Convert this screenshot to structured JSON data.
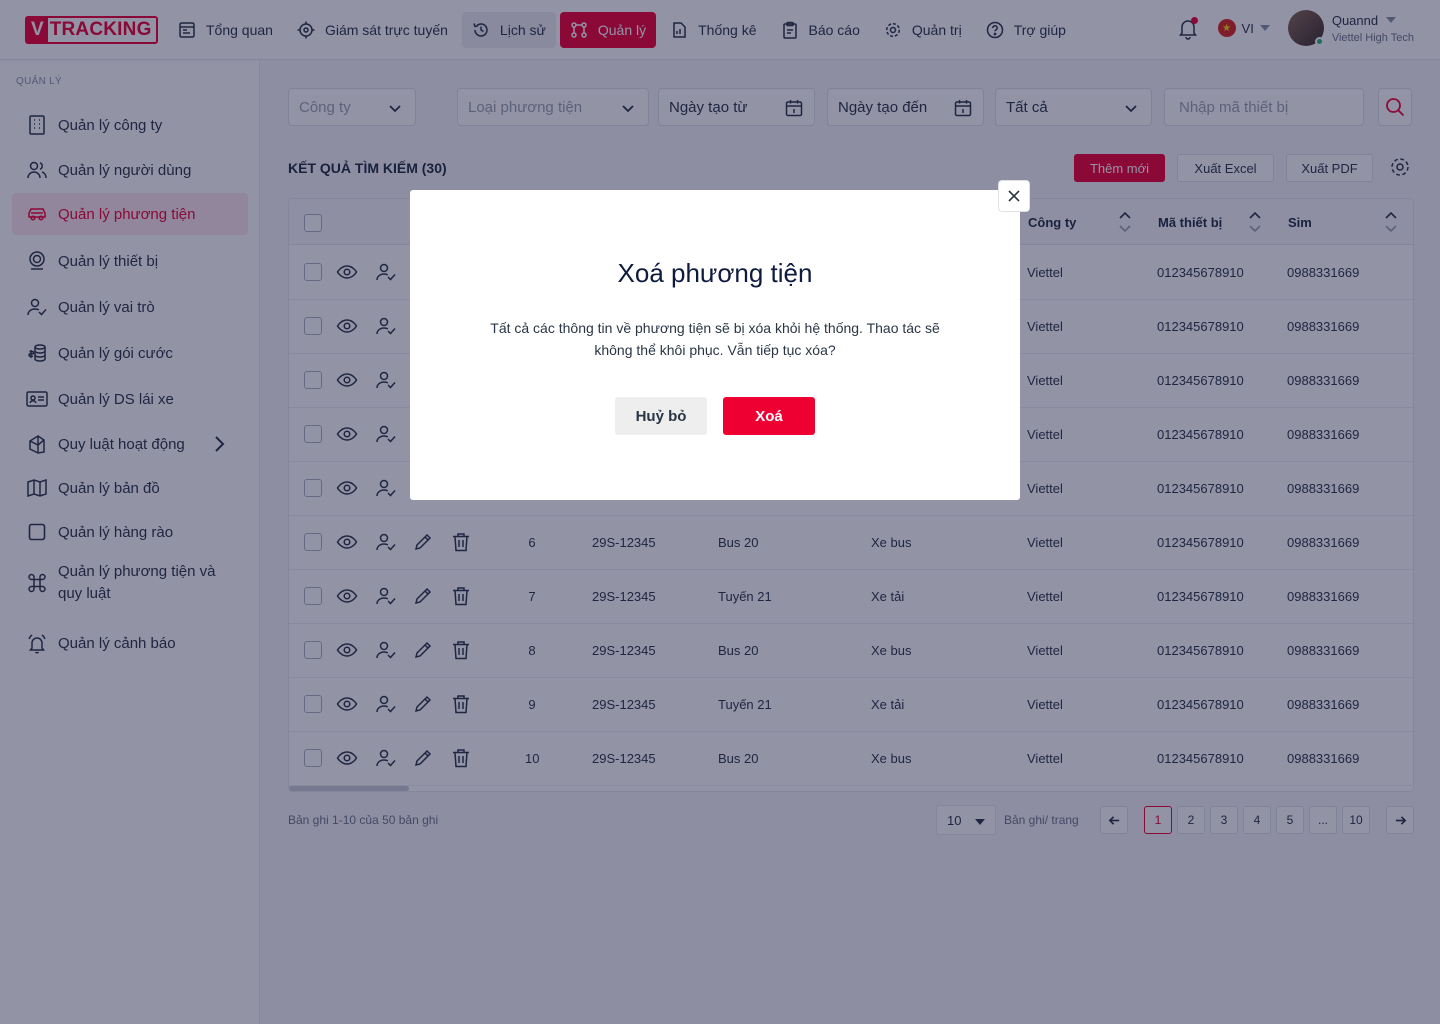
{
  "brand": {
    "logo_v": "V",
    "logo_text": "TRACKING",
    "color": "#ee0033"
  },
  "nav": [
    {
      "label": "Tổng quan",
      "icon": "dashboard-icon"
    },
    {
      "label": "Giám sát trực tuyến",
      "icon": "target-icon"
    },
    {
      "label": "Lịch sử",
      "icon": "history-icon"
    },
    {
      "label": "Quản lý",
      "icon": "manage-icon",
      "active": true
    },
    {
      "label": "Thống kê",
      "icon": "stats-icon"
    },
    {
      "label": "Báo cáo",
      "icon": "report-icon"
    },
    {
      "label": "Quản trị",
      "icon": "gear-icon"
    },
    {
      "label": "Trợ giúp",
      "icon": "help-icon"
    }
  ],
  "header_right": {
    "lang": "VI",
    "user_name": "Quannd",
    "user_org": "Viettel High Tech"
  },
  "sidebar": {
    "title": "QUẢN LÝ",
    "items": [
      {
        "label": "Quản lý công ty",
        "icon": "building-icon"
      },
      {
        "label": "Quản lý người dùng",
        "icon": "users-icon"
      },
      {
        "label": "Quản lý phương tiện",
        "icon": "car-icon",
        "active": true
      },
      {
        "label": "Quản lý thiết bị",
        "icon": "device-icon"
      },
      {
        "label": "Quản lý vai trò",
        "icon": "user-check-icon"
      },
      {
        "label": "Quản lý gói cước",
        "icon": "coins-icon"
      },
      {
        "label": "Quản lý DS lái xe",
        "icon": "id-card-icon"
      },
      {
        "label": "Quy luật hoạt động",
        "icon": "rules-icon",
        "has_children": true
      },
      {
        "label": "Quản lý bản đồ",
        "icon": "map-icon"
      },
      {
        "label": "Quản lý hàng rào",
        "icon": "square-icon"
      },
      {
        "label": "Quản lý phương tiện và quy luật",
        "icon": "command-icon"
      },
      {
        "label": "Quản lý cảnh báo",
        "icon": "alarm-icon"
      }
    ]
  },
  "filters": {
    "company": "Công ty",
    "vehicle_type": "Loại phương tiện",
    "date_from": "Ngày tạo từ",
    "date_to": "Ngày tạo đến",
    "status": "Tất cả",
    "device_placeholder": "Nhập mã thiết bị"
  },
  "results": {
    "title": "KẾT QUẢ TÌM KIẾM (30)",
    "add": "Thêm mới",
    "excel": "Xuất Excel",
    "pdf": "Xuất PDF"
  },
  "table": {
    "headers": [
      "Công ty",
      "Mã thiết bị",
      "Sim"
    ],
    "rows": [
      {
        "stt": "",
        "plate": "",
        "name": "",
        "type": "",
        "company": "Viettel",
        "device": "012345678910",
        "sim": "0988331669"
      },
      {
        "stt": "",
        "plate": "",
        "name": "",
        "type": "",
        "company": "Viettel",
        "device": "012345678910",
        "sim": "0988331669"
      },
      {
        "stt": "",
        "plate": "",
        "name": "",
        "type": "",
        "company": "Viettel",
        "device": "012345678910",
        "sim": "0988331669"
      },
      {
        "stt": "",
        "plate": "",
        "name": "",
        "type": "",
        "company": "Viettel",
        "device": "012345678910",
        "sim": "0988331669"
      },
      {
        "stt": "",
        "plate": "",
        "name": "",
        "type": "",
        "company": "Viettel",
        "device": "012345678910",
        "sim": "0988331669"
      },
      {
        "stt": "6",
        "plate": "29S-12345",
        "name": "Bus 20",
        "type": "Xe bus",
        "company": "Viettel",
        "device": "012345678910",
        "sim": "0988331669"
      },
      {
        "stt": "7",
        "plate": "29S-12345",
        "name": "Tuyến 21",
        "type": "Xe tải",
        "company": "Viettel",
        "device": "012345678910",
        "sim": "0988331669"
      },
      {
        "stt": "8",
        "plate": "29S-12345",
        "name": "Bus 20",
        "type": "Xe bus",
        "company": "Viettel",
        "device": "012345678910",
        "sim": "0988331669"
      },
      {
        "stt": "9",
        "plate": "29S-12345",
        "name": "Tuyến 21",
        "type": "Xe tải",
        "company": "Viettel",
        "device": "012345678910",
        "sim": "0988331669"
      },
      {
        "stt": "10",
        "plate": "29S-12345",
        "name": "Bus 20",
        "type": "Xe bus",
        "company": "Viettel",
        "device": "012345678910",
        "sim": "0988331669"
      }
    ]
  },
  "pagination": {
    "info": "Bản ghi 1-10 của 50 bản ghi",
    "per_page": "10",
    "per_page_label": "Bản ghi/ trang",
    "pages": [
      "1",
      "2",
      "3",
      "4",
      "5",
      "...",
      "10"
    ]
  },
  "modal": {
    "title": "Xoá phương tiện",
    "message": "Tất cả các thông tin về phương tiện sẽ bị xóa khỏi hệ thống. Thao tác sẽ không thể khôi phục. Vẫn tiếp tục xóa?",
    "cancel": "Huỷ bỏ",
    "confirm": "Xoá"
  }
}
